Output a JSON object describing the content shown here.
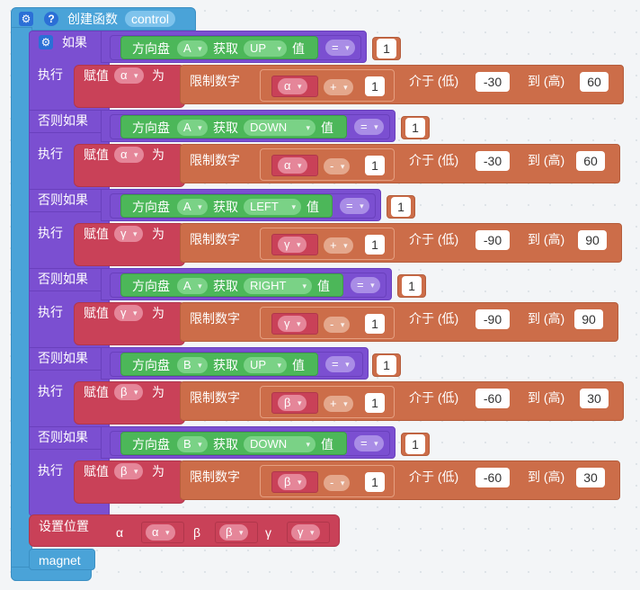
{
  "function": {
    "keyword": "创建函数",
    "name": "control",
    "gear_icon": "gear-icon",
    "help_icon": "question-icon"
  },
  "labels": {
    "if": "如果",
    "do": "执行",
    "elseif": "否则如果",
    "assign": "赋值",
    "as": "为",
    "clamp": "限制数字",
    "between_low": "介于 (低)",
    "to_high": "到 (高)",
    "joystick": "方向盘",
    "get": "获取",
    "value": "值"
  },
  "clauses": [
    {
      "stick": "A",
      "dir": "UP",
      "cmp": "=",
      "cmpval": "1",
      "var": "α",
      "op": "+",
      "step": "1",
      "low": "-30",
      "high": "60"
    },
    {
      "stick": "A",
      "dir": "DOWN",
      "cmp": "=",
      "cmpval": "1",
      "var": "α",
      "op": "-",
      "step": "1",
      "low": "-30",
      "high": "60"
    },
    {
      "stick": "A",
      "dir": "LEFT",
      "cmp": "=",
      "cmpval": "1",
      "var": "γ",
      "op": "+",
      "step": "1",
      "low": "-90",
      "high": "90"
    },
    {
      "stick": "A",
      "dir": "RIGHT",
      "cmp": "=",
      "cmpval": "1",
      "var": "γ",
      "op": "-",
      "step": "1",
      "low": "-90",
      "high": "90"
    },
    {
      "stick": "B",
      "dir": "UP",
      "cmp": "=",
      "cmpval": "1",
      "var": "β",
      "op": "+",
      "step": "1",
      "low": "-60",
      "high": "30"
    },
    {
      "stick": "B",
      "dir": "DOWN",
      "cmp": "=",
      "cmpval": "1",
      "var": "β",
      "op": "-",
      "step": "1",
      "low": "-60",
      "high": "30"
    }
  ],
  "set_position": {
    "label": "设置位置",
    "alpha_label": "α",
    "alpha_var": "α",
    "beta_label": "β",
    "beta_var": "β",
    "gamma_label": "γ",
    "gamma_var": "γ"
  },
  "magnet": {
    "label": "magnet"
  },
  "colors": {
    "function": "#4aa3d8",
    "control": "#7b4fd1",
    "variable": "#c94158",
    "math": "#cc6d49",
    "joystick": "#4cb759"
  }
}
